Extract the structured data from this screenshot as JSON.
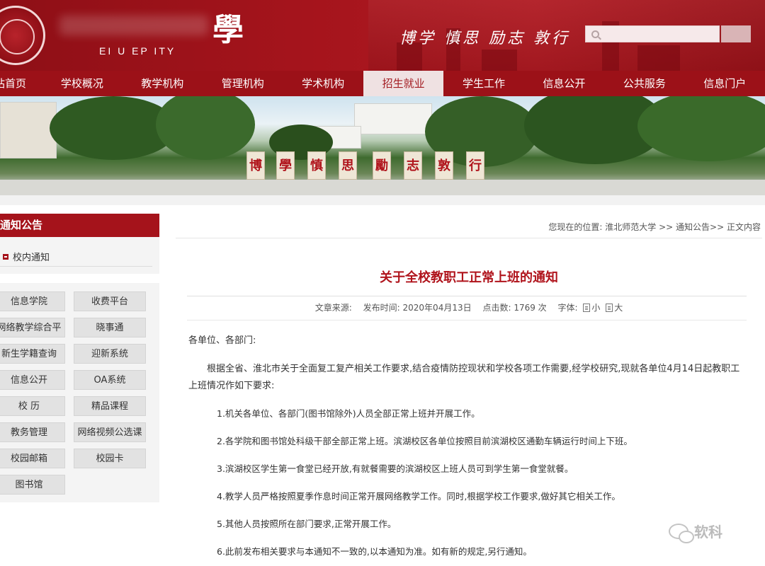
{
  "header": {
    "school_char": "學",
    "school_en": "EI   U   EP   ITY",
    "motto": "博学 慎思 励志 敦行",
    "search_placeholder": ""
  },
  "nav": {
    "items": [
      {
        "label": "站首页"
      },
      {
        "label": "学校概况"
      },
      {
        "label": "教学机构"
      },
      {
        "label": "管理机构"
      },
      {
        "label": "学术机构"
      },
      {
        "label": "招生就业"
      },
      {
        "label": "学生工作"
      },
      {
        "label": "信息公开"
      },
      {
        "label": "公共服务"
      },
      {
        "label": "信息门户"
      }
    ],
    "active_index": 5
  },
  "banner": {
    "stone_chars": [
      "博",
      "學",
      "慎",
      "思",
      "勵",
      "志",
      "敦",
      "行"
    ]
  },
  "sidebar": {
    "title": "通知公告",
    "sub_item": "校内通知",
    "links": [
      {
        "label": "信息学院"
      },
      {
        "label": "收费平台"
      },
      {
        "label": "网络教学综合平"
      },
      {
        "label": "晓事通"
      },
      {
        "label": "新生学籍查询"
      },
      {
        "label": "迎新系统"
      },
      {
        "label": "信息公开"
      },
      {
        "label": "OA系统"
      },
      {
        "label": "校 历"
      },
      {
        "label": "精品课程"
      },
      {
        "label": "教务管理"
      },
      {
        "label": "网络视频公选课"
      },
      {
        "label": "校园邮箱"
      },
      {
        "label": "校园卡"
      },
      {
        "label": "图书馆"
      }
    ]
  },
  "breadcrumb": {
    "prefix": "您现在的位置:",
    "path": [
      {
        "label": "淮北师范大学"
      },
      {
        "label": "通知公告"
      },
      {
        "label": "正文内容"
      }
    ],
    "sep1": ">>",
    "sep2": ">>"
  },
  "article": {
    "title": "关于全校教职工正常上班的通知",
    "meta": {
      "source_label": "文章来源:",
      "source_value": "",
      "date_label": "发布时间:",
      "date_value": "2020年04月13日",
      "hits_label": "点击数:",
      "hits_value": "1769 次",
      "font_label": "字体:",
      "font_small": "小",
      "font_large": "大"
    },
    "salutation": "各单位、各部门:",
    "intro": "根据全省、淮北市关于全面复工复产相关工作要求,结合疫情防控现状和学校各项工作需要,经学校研究,现就各单位4月14日起教职工上班情况作如下要求:",
    "items": [
      "1.机关各单位、各部门(图书馆除外)人员全部正常上班并开展工作。",
      "2.各学院和图书馆处科级干部全部正常上班。滨湖校区各单位按照目前滨湖校区通勤车辆运行时间上下班。",
      "3.滨湖校区学生第一食堂已经开放,有就餐需要的滨湖校区上班人员可到学生第一食堂就餐。",
      "4.教学人员严格按照夏季作息时间正常开展网络教学工作。同时,根据学校工作要求,做好其它相关工作。",
      "5.其他人员按照所在部门要求,正常开展工作。",
      "6.此前发布相关要求与本通知不一致的,以本通知为准。如有新的规定,另行通知。"
    ]
  },
  "watermark": {
    "text": "软科"
  },
  "colors": {
    "brand": "#a5131b",
    "title_red": "#b0141c",
    "nav_active_bg": "#efe1e2"
  }
}
